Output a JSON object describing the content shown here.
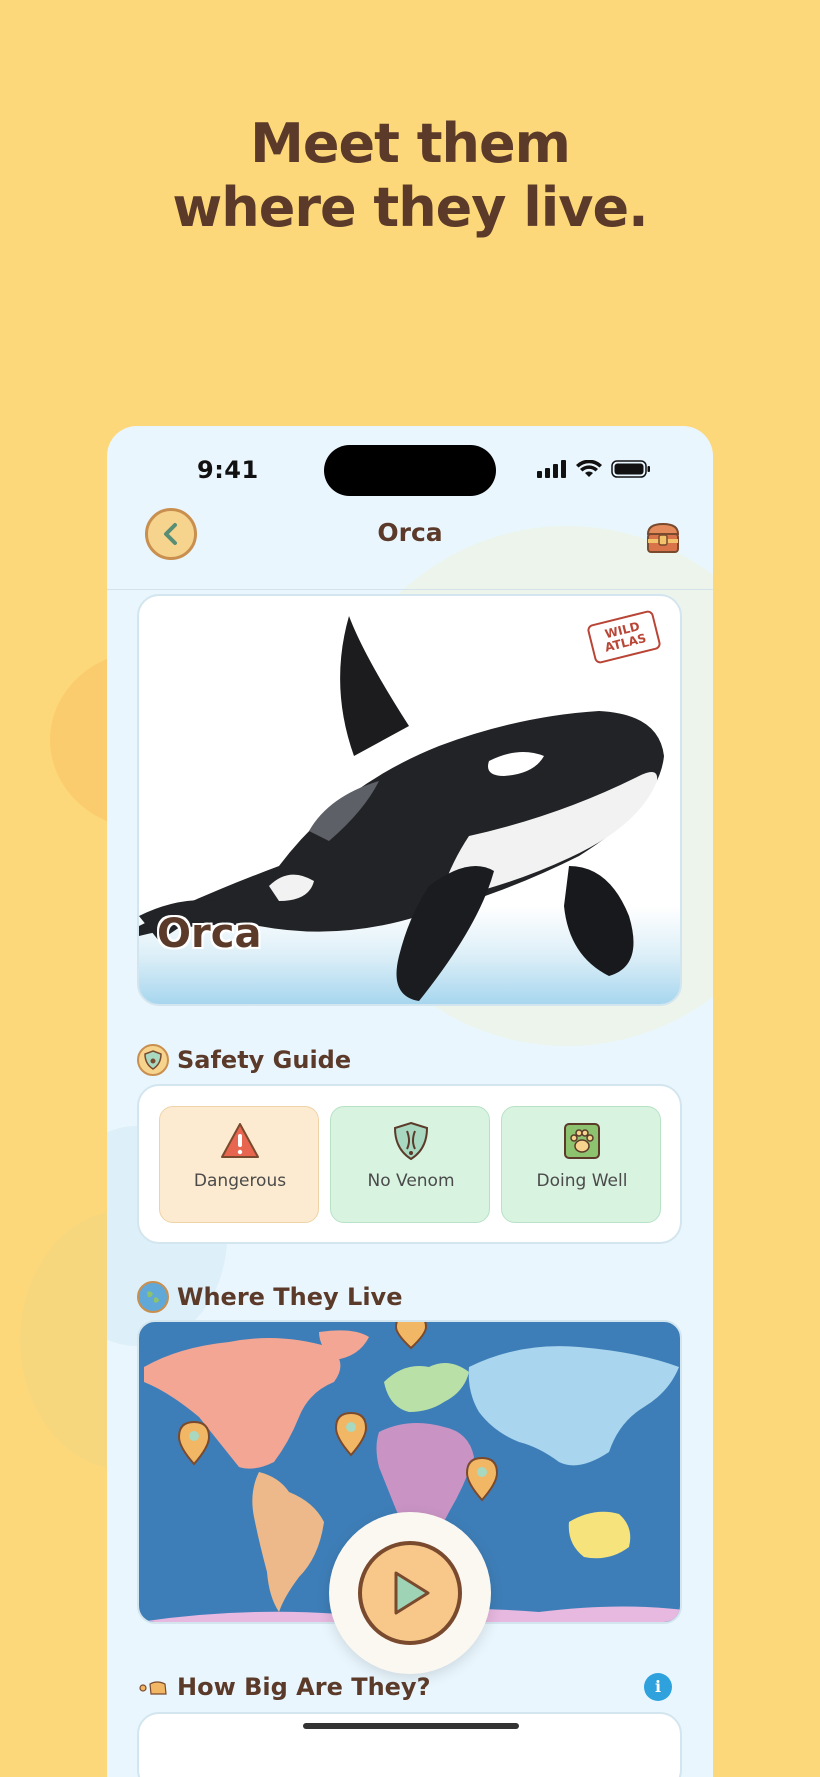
{
  "headline": {
    "line1": "Meet them",
    "line2": "where they live."
  },
  "status_bar": {
    "time": "9:41"
  },
  "nav": {
    "title": "Orca"
  },
  "hero": {
    "name": "Orca",
    "stamp_line1": "WILD",
    "stamp_line2": "ATLAS"
  },
  "safety": {
    "title": "Safety Guide",
    "items": [
      {
        "label": "Dangerous",
        "icon": "warning-icon",
        "bg": "#FCEBD0"
      },
      {
        "label": "No Venom",
        "icon": "no-venom-icon",
        "bg": "#D8F3E0"
      },
      {
        "label": "Doing Well",
        "icon": "paw-icon",
        "bg": "#D8F3E0"
      }
    ]
  },
  "habitat": {
    "title": "Where They Live"
  },
  "size": {
    "title": "How Big Are They?",
    "info_label": "i"
  },
  "colors": {
    "background": "#FDD87A",
    "brand_brown": "#5B3A2A",
    "phone_bg": "#E9F6FD",
    "ocean": "#3E7EB8"
  }
}
